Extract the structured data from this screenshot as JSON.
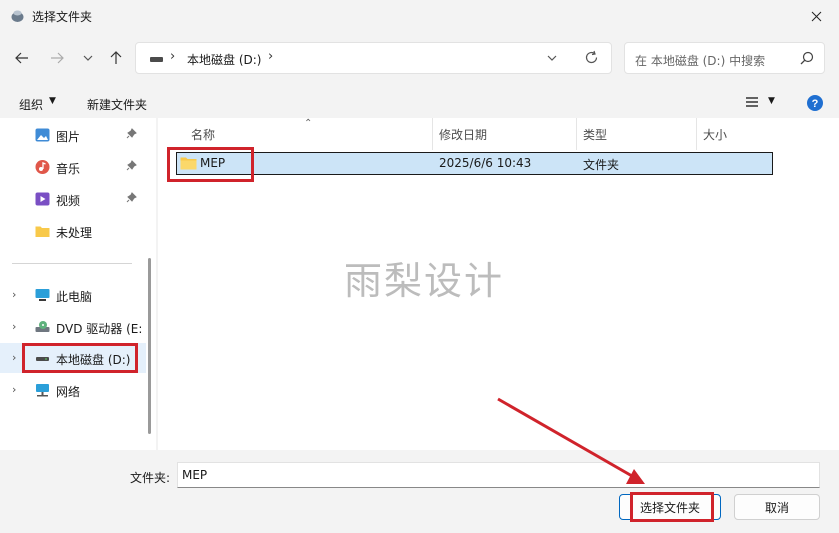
{
  "window": {
    "title": "选择文件夹"
  },
  "address": {
    "path_label": "本地磁盘 (D:)"
  },
  "search": {
    "placeholder": "在 本地磁盘 (D:) 中搜索"
  },
  "toolbar": {
    "organize_label": "组织",
    "new_folder_label": "新建文件夹"
  },
  "sidebar": {
    "items": [
      {
        "label": "图片",
        "icon": "pictures-icon",
        "pinned": true
      },
      {
        "label": "音乐",
        "icon": "music-icon",
        "pinned": true
      },
      {
        "label": "视频",
        "icon": "videos-icon",
        "pinned": true
      },
      {
        "label": "未处理",
        "icon": "folder-icon",
        "pinned": false
      },
      {
        "label": "此电脑",
        "icon": "computer-icon"
      },
      {
        "label": "DVD 驱动器 (E:",
        "icon": "dvd-drive-icon"
      },
      {
        "label": "本地磁盘 (D:)",
        "icon": "drive-icon",
        "selected": true
      },
      {
        "label": "网络",
        "icon": "network-icon"
      }
    ]
  },
  "columns": {
    "name": "名称",
    "date": "修改日期",
    "type": "类型",
    "size": "大小"
  },
  "files": [
    {
      "name": "MEP",
      "modified": "2025/6/6 10:43",
      "type": "文件夹",
      "selected": true
    }
  ],
  "watermark": "雨梨设计",
  "footer": {
    "folder_label": "文件夹:",
    "folder_value": "MEP",
    "select_button": "选择文件夹",
    "cancel_button": "取消"
  },
  "colors": {
    "accent": "#0067c0",
    "selection": "#cce4f7",
    "annotation": "#d0232b",
    "folder": "#f8c94a"
  }
}
